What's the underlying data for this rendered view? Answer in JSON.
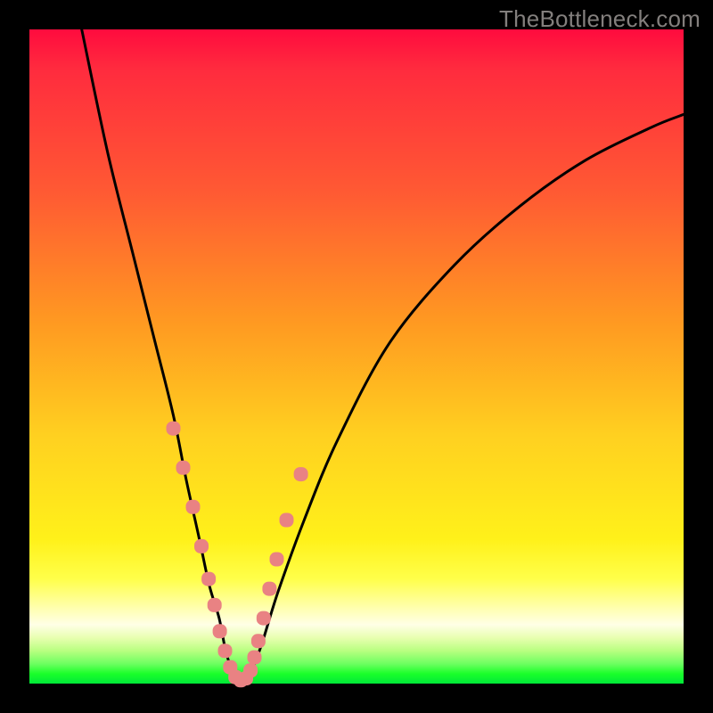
{
  "watermark": "TheBottleneck.com",
  "chart_data": {
    "type": "line",
    "title": "",
    "xlabel": "",
    "ylabel": "",
    "xlim": [
      0,
      100
    ],
    "ylim": [
      0,
      100
    ],
    "series": [
      {
        "name": "bottleneck-curve",
        "x": [
          8,
          12,
          16,
          19,
          22,
          24,
          26,
          27.5,
          29,
          30,
          31,
          32,
          33,
          34,
          35.5,
          38,
          42,
          47,
          55,
          65,
          75,
          85,
          95,
          100
        ],
        "values": [
          100,
          81,
          65,
          53,
          41,
          31,
          22,
          15,
          10,
          5,
          2,
          0,
          0,
          2,
          6,
          14,
          25,
          37,
          52,
          64,
          73,
          80,
          85,
          87
        ]
      }
    ],
    "markers": {
      "name": "highlight-points",
      "color": "#e98283",
      "x": [
        22,
        23.5,
        25,
        26.3,
        27.4,
        28.3,
        29.1,
        29.9,
        30.7,
        31.5,
        32.3,
        33.1,
        33.8,
        34.4,
        35.0,
        35.8,
        36.7,
        37.8,
        39.3,
        41.5
      ],
      "values": [
        39,
        33,
        27,
        21,
        16,
        12,
        8,
        5,
        2.5,
        1,
        0.5,
        0.8,
        2,
        4,
        6.5,
        10,
        14.5,
        19,
        25,
        32
      ]
    },
    "curve_min": {
      "x": 32.5,
      "value": 0
    }
  }
}
